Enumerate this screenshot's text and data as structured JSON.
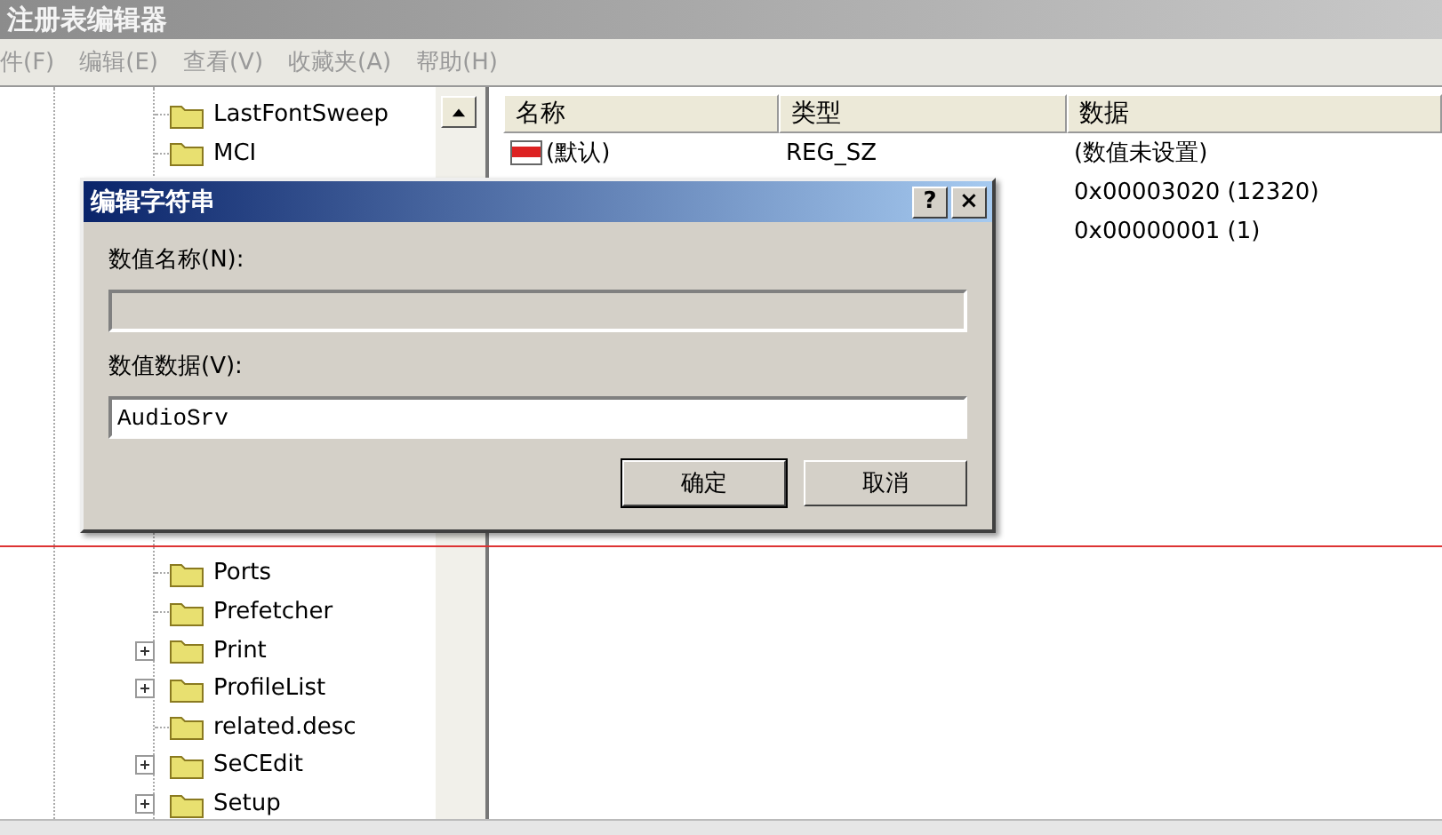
{
  "window": {
    "title": "注册表编辑器"
  },
  "menu": [
    {
      "label": "件(F)"
    },
    {
      "label": "编辑(E)"
    },
    {
      "label": "查看(V)"
    },
    {
      "label": "收藏夹(A)"
    },
    {
      "label": "帮助(H)"
    }
  ],
  "tree": {
    "items_top": [
      {
        "label": "LastFontSweep",
        "has_children": false
      },
      {
        "label": "MCI",
        "has_children": false
      }
    ],
    "items_bottom": [
      {
        "label": "Ports",
        "has_children": false
      },
      {
        "label": "Prefetcher",
        "has_children": false
      },
      {
        "label": "Print",
        "has_children": true
      },
      {
        "label": "ProfileList",
        "has_children": true
      },
      {
        "label": "related.desc",
        "has_children": false
      },
      {
        "label": "SeCEdit",
        "has_children": true
      },
      {
        "label": "Setup",
        "has_children": true
      }
    ]
  },
  "list": {
    "columns": [
      "名称",
      "类型",
      "数据"
    ],
    "rows": [
      {
        "name": "(默认)",
        "type": "REG_SZ",
        "data": "(数值未设置)"
      },
      {
        "data": "0x00003020 (12320)"
      },
      {
        "data": "0x00000001 (1)"
      }
    ]
  },
  "dialog": {
    "title": "编辑字符串",
    "help_button": "?",
    "close_button": "×",
    "name_label": "数值名称(N):",
    "name_disabled": true,
    "data_label": "数值数据(V):",
    "data_value": "AudioSrv",
    "buttons": [
      {
        "label": "确定",
        "default": true
      },
      {
        "label": "取消",
        "default": false
      }
    ]
  }
}
